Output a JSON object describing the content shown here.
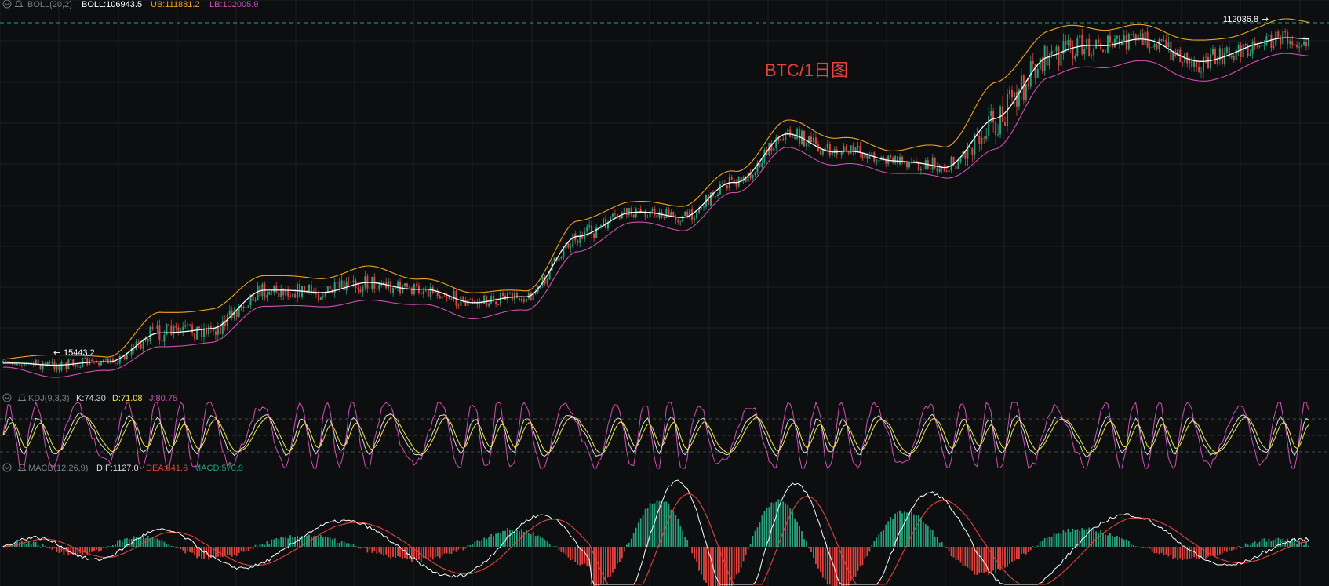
{
  "title": "BTC/1日图",
  "colors": {
    "background": "#0d0e10",
    "grid": "#1c1f24",
    "up": "#26a17b",
    "down": "#e2433e",
    "mid": "#ffffff",
    "ub": "#f0a321",
    "lb": "#d04fb2",
    "k": "#dcdcdc",
    "d": "#f5e83c",
    "j": "#d04fb2",
    "dif": "#ffffff",
    "dea": "#e2433e",
    "title": "#e2433e",
    "price_line": "#26a17b"
  },
  "boll": {
    "name": "BOLL(20,2)",
    "boll_label": "BOLL:106943.5",
    "ub_label": "UB:111881.2",
    "lb_label": "LB:102005.9"
  },
  "kdj": {
    "name": "KDJ(9,3,3)",
    "k_label": "K:74.30",
    "d_label": "D:71.08",
    "j_label": "J:80.75"
  },
  "macd": {
    "name": "MACD(12,26,9)",
    "dif_label": "DIF:1127.0",
    "dea_label": "DEA:841.6",
    "macd_label": "MACD:570.9"
  },
  "chart_data": {
    "type": "line",
    "price_high_label": "112036.8",
    "price_low_label": "15443.2",
    "x": [
      0,
      4,
      8,
      12,
      16,
      20,
      24,
      28,
      32,
      36,
      40,
      44,
      48,
      52,
      56,
      60,
      64,
      68,
      72,
      76,
      80,
      84,
      88,
      92,
      96,
      100
    ],
    "series": [
      {
        "name": "BOLL",
        "values": [
          17800,
          17300,
          18100,
          26000,
          27400,
          38000,
          37000,
          39600,
          38200,
          34700,
          35900,
          52000,
          59000,
          58200,
          67400,
          80000,
          75500,
          73600,
          71500,
          84600,
          101600,
          104900,
          105800,
          100200,
          105700,
          106943.5
        ]
      },
      {
        "name": "UB",
        "values": [
          18900,
          20100,
          19500,
          31500,
          32900,
          41900,
          40900,
          43800,
          41200,
          37400,
          37600,
          55900,
          62000,
          61400,
          70500,
          83700,
          79000,
          76600,
          76900,
          94700,
          108300,
          109700,
          109100,
          106300,
          110000,
          111881.2
        ]
      },
      {
        "name": "LB",
        "values": [
          16700,
          14000,
          15700,
          22300,
          23600,
          33600,
          33200,
          34600,
          34200,
          30300,
          32200,
          47900,
          56000,
          54800,
          64700,
          76000,
          72200,
          70000,
          68800,
          76300,
          95600,
          99300,
          99600,
          94800,
          101400,
          102005.9
        ]
      }
    ]
  }
}
